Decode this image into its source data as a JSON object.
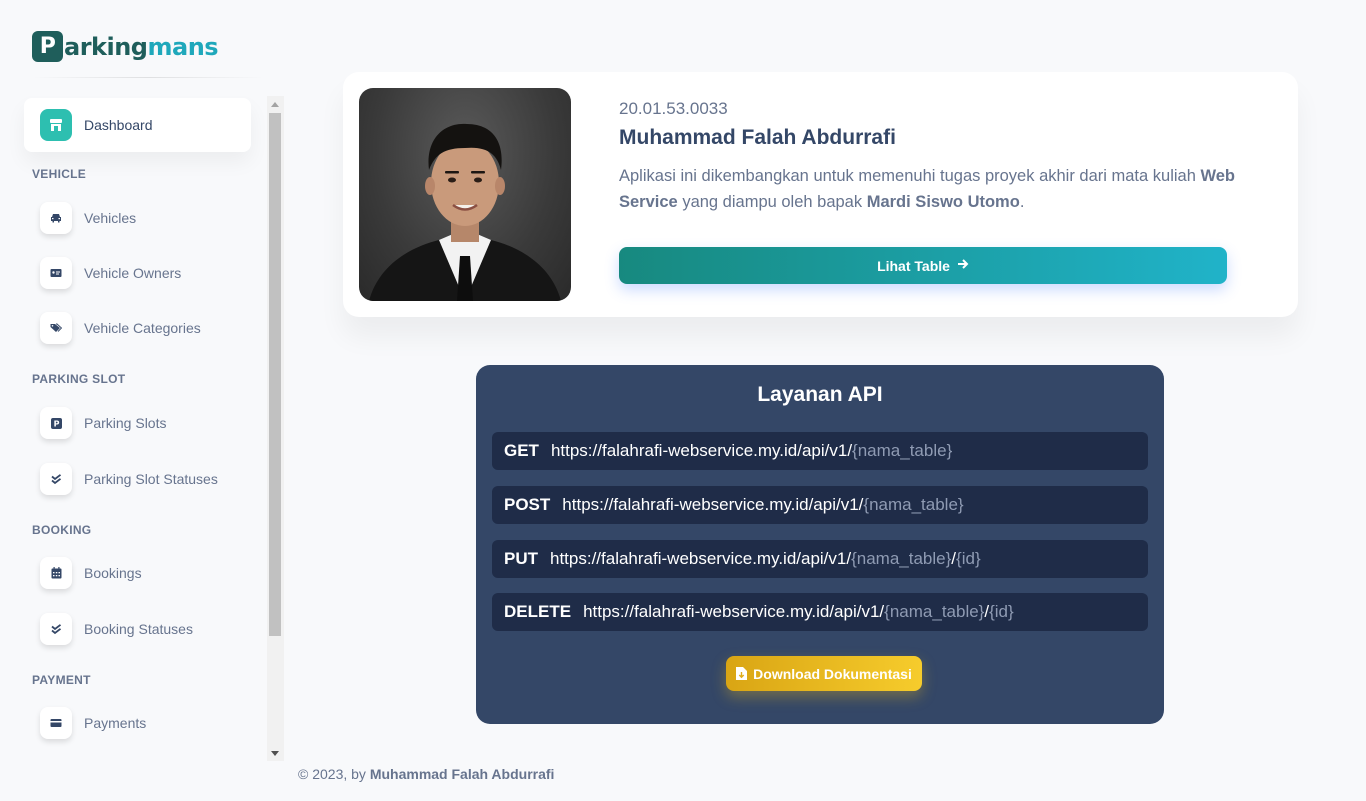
{
  "brand": {
    "letter": "P",
    "part1": "arking",
    "part2": "mans"
  },
  "sidebar": {
    "dashboard": "Dashboard",
    "sections": {
      "vehicle": "VEHICLE",
      "parking_slot": "PARKING SLOT",
      "booking": "BOOKING",
      "payment": "PAYMENT"
    },
    "items": {
      "vehicles": "Vehicles",
      "vehicle_owners": "Vehicle Owners",
      "vehicle_categories": "Vehicle Categories",
      "parking_slots": "Parking Slots",
      "parking_slot_statuses": "Parking Slot Statuses",
      "bookings": "Bookings",
      "booking_statuses": "Booking Statuses",
      "payments": "Payments"
    }
  },
  "profile": {
    "nim": "20.01.53.0033",
    "name": "Muhammad Falah Abdurrafi",
    "desc_1": "Aplikasi ini dikembangkan untuk memenuhi tugas proyek akhir dari mata kuliah",
    "course": "Web Service",
    "desc_2": "yang diampu oleh bapak",
    "lecturer": "Mardi Siswo Utomo",
    "desc_end": ".",
    "button": "Lihat Table"
  },
  "api": {
    "title": "Layanan API",
    "base_url": "https://falahrafi-webservice.my.id/api/v1/",
    "table_placeholder": "{nama_table}",
    "id_placeholder": "{id}",
    "slash": "/",
    "methods": {
      "get": "GET",
      "post": "POST",
      "put": "PUT",
      "delete": "DELETE"
    },
    "download_button": "Download Dokumentasi"
  },
  "footer": {
    "prefix": "© 2023, by",
    "author": "Muhammad Falah Abdurrafi"
  },
  "colors": {
    "accent_teal": "#2dbfb0",
    "api_card": "#344767",
    "download_yellow": "#f6cc2c",
    "brand_dark": "#1f5e5b",
    "brand_light": "#1fa8bb"
  },
  "icons": {
    "dashboard": "shop-icon",
    "vehicles": "car-icon",
    "vehicle_owners": "id-card-icon",
    "vehicle_categories": "tags-icon",
    "parking_slots": "parking-icon",
    "parking_slot_statuses": "double-check-icon",
    "bookings": "calendar-icon",
    "booking_statuses": "double-check-icon",
    "payments": "credit-card-icon"
  }
}
